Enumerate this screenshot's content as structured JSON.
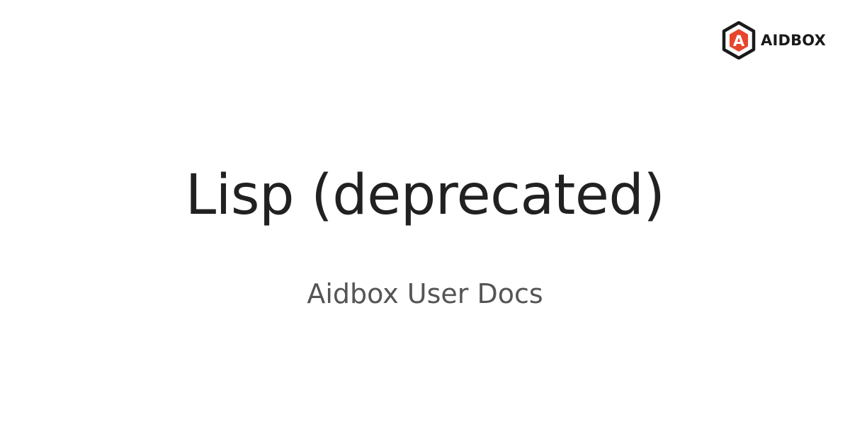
{
  "brand": {
    "name": "AIDBOX",
    "logo_letter": "A",
    "accent_color": "#e8452c",
    "mark_color": "#1a1a1a"
  },
  "page": {
    "title": "Lisp (deprecated)",
    "subtitle": "Aidbox User Docs",
    "title_color": "#212121",
    "subtitle_color": "#555555",
    "background": "#ffffff"
  }
}
